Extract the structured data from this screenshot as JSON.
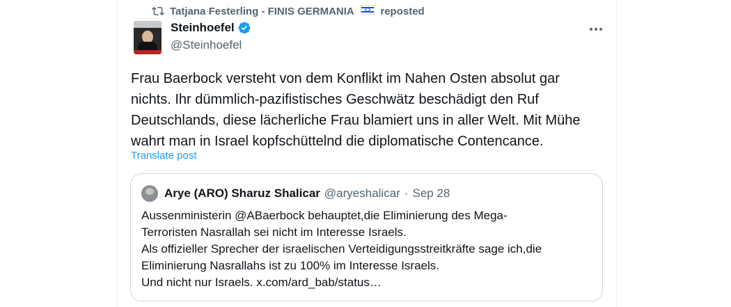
{
  "repost": {
    "reposter": "Tatjana Festerling - FINIS GERMANIA",
    "flag_icon": "israel-flag-icon",
    "action": "reposted"
  },
  "author": {
    "display_name": "Steinhoefel",
    "handle": "@Steinhoefel",
    "verified": true,
    "verified_color": "#1d9bf0"
  },
  "tweet": {
    "lines": [
      "Frau Baerbock versteht von dem Konflikt im Nahen Osten absolut gar",
      "nichts. Ihr dümmlich-pazifistisches Geschwätz beschädigt den Ruf",
      "Deutschlands, diese lächerliche Frau blamiert uns in aller Welt. Mit Mühe",
      "wahrt man in Israel kopfschüttelnd die diplomatische Contencance."
    ],
    "translate_label": "Translate post"
  },
  "quote": {
    "display_name": "Arye (ARO) Sharuz Shalicar",
    "handle": "@aryeshalicar",
    "separator": "·",
    "date": "Sep 28",
    "lines": [
      "Aussenministerin @ABaerbock behauptet,die Eliminierung des Mega-",
      "Terroristen Nasrallah sei nicht im Interesse Israels.",
      "Als offizieller Sprecher der israelischen Verteidigungsstreitkräfte  sage ich,die",
      "Eliminierung Nasrallahs ist zu 100% im Interesse Israels.",
      "Und nicht nur Israels. x.com/ard_bab/status…"
    ]
  },
  "colors": {
    "link": "#1d9bf0",
    "secondary_text": "#536471",
    "border": "#cfd9de"
  }
}
